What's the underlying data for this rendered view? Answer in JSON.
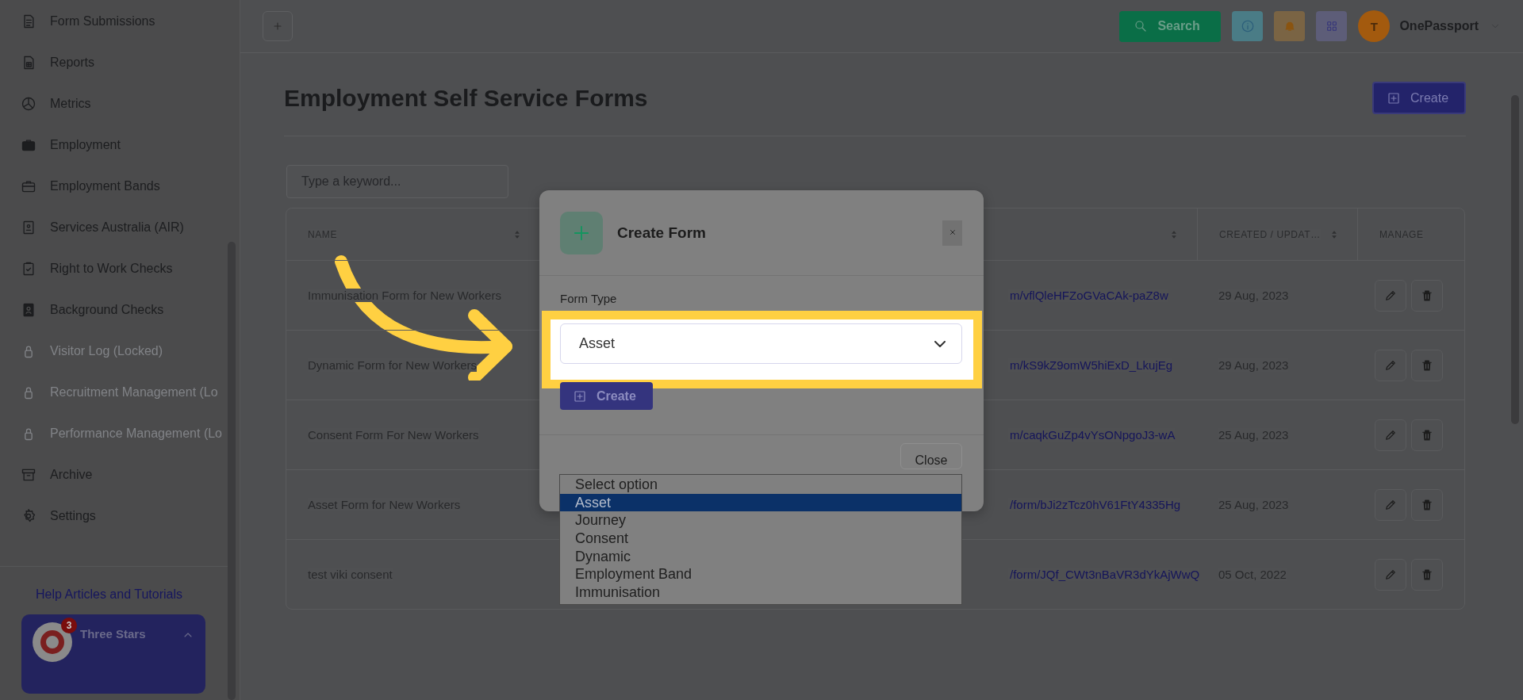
{
  "sidebar": {
    "items": [
      {
        "label": "Form Submissions",
        "locked": false
      },
      {
        "label": "Reports",
        "locked": false
      },
      {
        "label": "Metrics",
        "locked": false
      },
      {
        "label": "Employment",
        "locked": false
      },
      {
        "label": "Employment Bands",
        "locked": false
      },
      {
        "label": "Services Australia (AIR)",
        "locked": false
      },
      {
        "label": "Right to Work Checks",
        "locked": false
      },
      {
        "label": "Background Checks",
        "locked": false
      },
      {
        "label": "Visitor Log (Locked)",
        "locked": true
      },
      {
        "label": "Recruitment Management (Lo",
        "locked": true
      },
      {
        "label": "Performance Management (Lo",
        "locked": true
      },
      {
        "label": "Archive",
        "locked": false
      },
      {
        "label": "Settings",
        "locked": false
      }
    ],
    "help_link": "Help Articles and Tutorials",
    "account": {
      "name": "Three Stars",
      "badge": "3"
    }
  },
  "topbar": {
    "search_label": "Search",
    "user_initial": "T",
    "user_name": "OnePassport"
  },
  "page": {
    "title": "Employment Self Service Forms",
    "create_label": "Create",
    "search": {
      "placeholder": "Type a keyword..."
    }
  },
  "table": {
    "columns": [
      {
        "label": "NAME",
        "sortable": true
      },
      {
        "sortable": true
      },
      {
        "label": "CREATED / UPDAT…",
        "sortable": true
      },
      {
        "label": "MANAGE",
        "sortable": false
      }
    ],
    "rows": [
      {
        "name": "Immunisation Form for New Workers",
        "column_3": "m/vflQleHFZoGVaCAk-paZ8w",
        "created": "29 Aug, 2023"
      },
      {
        "name": "Dynamic Form for New Workers",
        "column_3": "m/kS9kZ9omW5hiExD_LkujEg",
        "created": "29 Aug, 2023"
      },
      {
        "name": "Consent Form For New Workers",
        "column_3": "m/caqkGuZp4vYsONpgoJ3-wA",
        "created": "25 Aug, 2023"
      },
      {
        "name": "Asset Form for New Workers",
        "column_3": "/form/bJi2zTcz0hV61FtY4335Hg",
        "created": "25 Aug, 2023"
      },
      {
        "name": "test viki consent",
        "column_3": "/form/JQf_CWt3nBaVR3dYkAjWwQ",
        "created": "05 Oct, 2022"
      }
    ]
  },
  "modal": {
    "title": "Create Form",
    "field_label": "Form Type",
    "select_value": "Asset",
    "create_label": "Create",
    "close_label": "Close",
    "options": [
      {
        "label": "Select option",
        "selected": false
      },
      {
        "label": "Asset",
        "selected": true
      },
      {
        "label": "Journey",
        "selected": false
      },
      {
        "label": "Consent",
        "selected": false
      },
      {
        "label": "Dynamic",
        "selected": false
      },
      {
        "label": "Employment Band",
        "selected": false
      },
      {
        "label": "Immunisation",
        "selected": false
      }
    ]
  }
}
